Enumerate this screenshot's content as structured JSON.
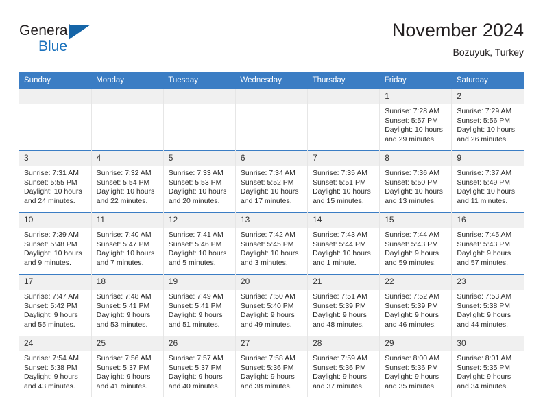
{
  "brand": {
    "name_part1": "General",
    "name_part2": "Blue",
    "logo_icon": "blue-triangle-icon"
  },
  "header": {
    "title": "November 2024",
    "location": "Bozuyuk, Turkey"
  },
  "colors": {
    "header_blue": "#3b7dc4",
    "brand_blue": "#1b72bd",
    "daynum_band": "#f0f0f0",
    "cell_border": "#e6e6e6",
    "text": "#2b2b2b"
  },
  "weekdays": [
    "Sunday",
    "Monday",
    "Tuesday",
    "Wednesday",
    "Thursday",
    "Friday",
    "Saturday"
  ],
  "labels": {
    "sunrise_prefix": "Sunrise:",
    "sunset_prefix": "Sunset:",
    "daylight_prefix": "Daylight:"
  },
  "weeks": [
    [
      {
        "day": "",
        "empty": true
      },
      {
        "day": "",
        "empty": true
      },
      {
        "day": "",
        "empty": true
      },
      {
        "day": "",
        "empty": true
      },
      {
        "day": "",
        "empty": true
      },
      {
        "day": "1",
        "sunrise": "Sunrise: 7:28 AM",
        "sunset": "Sunset: 5:57 PM",
        "daylight": "Daylight: 10 hours and 29 minutes."
      },
      {
        "day": "2",
        "sunrise": "Sunrise: 7:29 AM",
        "sunset": "Sunset: 5:56 PM",
        "daylight": "Daylight: 10 hours and 26 minutes."
      }
    ],
    [
      {
        "day": "3",
        "sunrise": "Sunrise: 7:31 AM",
        "sunset": "Sunset: 5:55 PM",
        "daylight": "Daylight: 10 hours and 24 minutes."
      },
      {
        "day": "4",
        "sunrise": "Sunrise: 7:32 AM",
        "sunset": "Sunset: 5:54 PM",
        "daylight": "Daylight: 10 hours and 22 minutes."
      },
      {
        "day": "5",
        "sunrise": "Sunrise: 7:33 AM",
        "sunset": "Sunset: 5:53 PM",
        "daylight": "Daylight: 10 hours and 20 minutes."
      },
      {
        "day": "6",
        "sunrise": "Sunrise: 7:34 AM",
        "sunset": "Sunset: 5:52 PM",
        "daylight": "Daylight: 10 hours and 17 minutes."
      },
      {
        "day": "7",
        "sunrise": "Sunrise: 7:35 AM",
        "sunset": "Sunset: 5:51 PM",
        "daylight": "Daylight: 10 hours and 15 minutes."
      },
      {
        "day": "8",
        "sunrise": "Sunrise: 7:36 AM",
        "sunset": "Sunset: 5:50 PM",
        "daylight": "Daylight: 10 hours and 13 minutes."
      },
      {
        "day": "9",
        "sunrise": "Sunrise: 7:37 AM",
        "sunset": "Sunset: 5:49 PM",
        "daylight": "Daylight: 10 hours and 11 minutes."
      }
    ],
    [
      {
        "day": "10",
        "sunrise": "Sunrise: 7:39 AM",
        "sunset": "Sunset: 5:48 PM",
        "daylight": "Daylight: 10 hours and 9 minutes."
      },
      {
        "day": "11",
        "sunrise": "Sunrise: 7:40 AM",
        "sunset": "Sunset: 5:47 PM",
        "daylight": "Daylight: 10 hours and 7 minutes."
      },
      {
        "day": "12",
        "sunrise": "Sunrise: 7:41 AM",
        "sunset": "Sunset: 5:46 PM",
        "daylight": "Daylight: 10 hours and 5 minutes."
      },
      {
        "day": "13",
        "sunrise": "Sunrise: 7:42 AM",
        "sunset": "Sunset: 5:45 PM",
        "daylight": "Daylight: 10 hours and 3 minutes."
      },
      {
        "day": "14",
        "sunrise": "Sunrise: 7:43 AM",
        "sunset": "Sunset: 5:44 PM",
        "daylight": "Daylight: 10 hours and 1 minute."
      },
      {
        "day": "15",
        "sunrise": "Sunrise: 7:44 AM",
        "sunset": "Sunset: 5:43 PM",
        "daylight": "Daylight: 9 hours and 59 minutes."
      },
      {
        "day": "16",
        "sunrise": "Sunrise: 7:45 AM",
        "sunset": "Sunset: 5:43 PM",
        "daylight": "Daylight: 9 hours and 57 minutes."
      }
    ],
    [
      {
        "day": "17",
        "sunrise": "Sunrise: 7:47 AM",
        "sunset": "Sunset: 5:42 PM",
        "daylight": "Daylight: 9 hours and 55 minutes."
      },
      {
        "day": "18",
        "sunrise": "Sunrise: 7:48 AM",
        "sunset": "Sunset: 5:41 PM",
        "daylight": "Daylight: 9 hours and 53 minutes."
      },
      {
        "day": "19",
        "sunrise": "Sunrise: 7:49 AM",
        "sunset": "Sunset: 5:41 PM",
        "daylight": "Daylight: 9 hours and 51 minutes."
      },
      {
        "day": "20",
        "sunrise": "Sunrise: 7:50 AM",
        "sunset": "Sunset: 5:40 PM",
        "daylight": "Daylight: 9 hours and 49 minutes."
      },
      {
        "day": "21",
        "sunrise": "Sunrise: 7:51 AM",
        "sunset": "Sunset: 5:39 PM",
        "daylight": "Daylight: 9 hours and 48 minutes."
      },
      {
        "day": "22",
        "sunrise": "Sunrise: 7:52 AM",
        "sunset": "Sunset: 5:39 PM",
        "daylight": "Daylight: 9 hours and 46 minutes."
      },
      {
        "day": "23",
        "sunrise": "Sunrise: 7:53 AM",
        "sunset": "Sunset: 5:38 PM",
        "daylight": "Daylight: 9 hours and 44 minutes."
      }
    ],
    [
      {
        "day": "24",
        "sunrise": "Sunrise: 7:54 AM",
        "sunset": "Sunset: 5:38 PM",
        "daylight": "Daylight: 9 hours and 43 minutes."
      },
      {
        "day": "25",
        "sunrise": "Sunrise: 7:56 AM",
        "sunset": "Sunset: 5:37 PM",
        "daylight": "Daylight: 9 hours and 41 minutes."
      },
      {
        "day": "26",
        "sunrise": "Sunrise: 7:57 AM",
        "sunset": "Sunset: 5:37 PM",
        "daylight": "Daylight: 9 hours and 40 minutes."
      },
      {
        "day": "27",
        "sunrise": "Sunrise: 7:58 AM",
        "sunset": "Sunset: 5:36 PM",
        "daylight": "Daylight: 9 hours and 38 minutes."
      },
      {
        "day": "28",
        "sunrise": "Sunrise: 7:59 AM",
        "sunset": "Sunset: 5:36 PM",
        "daylight": "Daylight: 9 hours and 37 minutes."
      },
      {
        "day": "29",
        "sunrise": "Sunrise: 8:00 AM",
        "sunset": "Sunset: 5:36 PM",
        "daylight": "Daylight: 9 hours and 35 minutes."
      },
      {
        "day": "30",
        "sunrise": "Sunrise: 8:01 AM",
        "sunset": "Sunset: 5:35 PM",
        "daylight": "Daylight: 9 hours and 34 minutes."
      }
    ]
  ]
}
